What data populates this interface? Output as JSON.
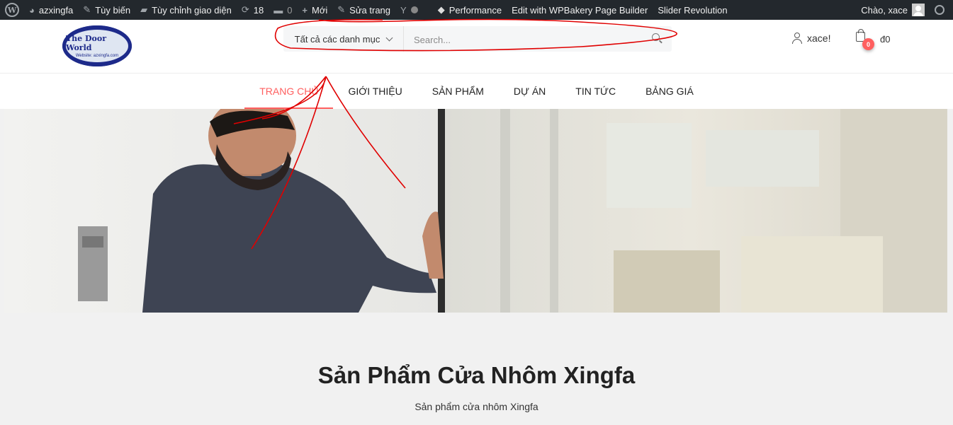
{
  "admin_bar": {
    "site_name": "azxingfa",
    "customize": "Tùy biến",
    "theme_customize": "Tùy chỉnh giao diện",
    "updates_count": "18",
    "comments_count": "0",
    "new": "Mới",
    "edit_page": "Sửa trang",
    "performance": "Performance",
    "wpbakery": "Edit with WPBakery Page Builder",
    "slider": "Slider Revolution",
    "greeting": "Chào, xace"
  },
  "header": {
    "logo_title": "The Door World",
    "logo_subtitle": "Website: azxingfa.com",
    "search_category": "Tất cả các danh mục",
    "search_placeholder": "Search...",
    "account_name": "xace!",
    "cart_count": "0",
    "cart_total": "đ0"
  },
  "nav": {
    "items": [
      "TRANG CHỦ",
      "GIỚI THIỆU",
      "SẢN PHẨM",
      "DỰ ÁN",
      "TIN TỨC",
      "BẢNG GIÁ"
    ],
    "active_index": 0
  },
  "section": {
    "title": "Sản Phẩm Cửa Nhôm Xingfa",
    "subtitle": "Sản phẩm cửa nhôm Xingfa"
  },
  "colors": {
    "accent": "#ff5f5f",
    "admin_bar_bg": "#23282d",
    "annotation": "#e00000"
  }
}
